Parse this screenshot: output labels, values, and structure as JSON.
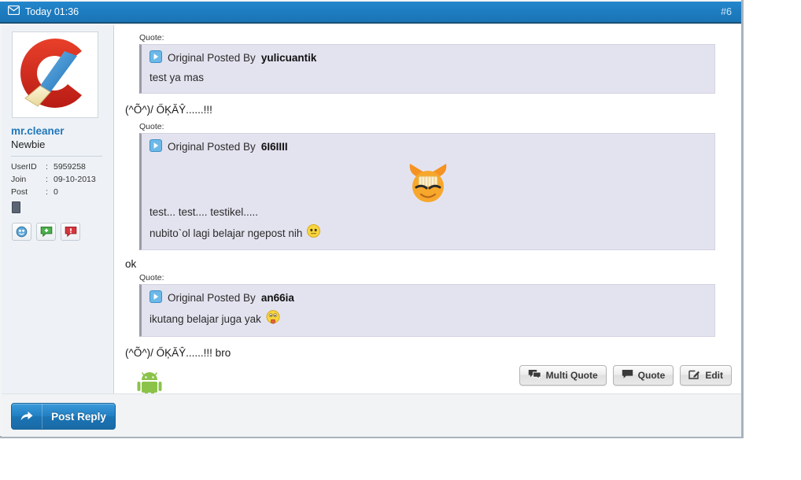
{
  "header": {
    "icon": "envelope-icon",
    "date": "Today 01:36",
    "post_number": "#6",
    "bg_color": "#1d7cc0"
  },
  "user": {
    "avatar_icon": "ccleaner-logo-avatar",
    "username": "mr.cleaner",
    "usertitle": "Newbie",
    "stats": [
      {
        "label": "UserID",
        "sep": ":",
        "value": "5959258"
      },
      {
        "label": "Join",
        "sep": ":",
        "value": "09-10-2013"
      },
      {
        "label": "Post",
        "sep": ":",
        "value": "0"
      }
    ],
    "device_badge": "mobile-device-icon",
    "mini_buttons": [
      {
        "name": "profile-globe-icon"
      },
      {
        "name": "reputation-add-icon"
      },
      {
        "name": "report-post-icon"
      }
    ]
  },
  "message": {
    "quote_label": "Quote:",
    "attrib_prefix": "Original Posted By",
    "blocks": [
      {
        "type": "quote",
        "author": "yulicuantik",
        "lines": [
          "test ya mas"
        ],
        "has_media": false,
        "emoticon": null
      },
      {
        "type": "text",
        "text": "(^Õ^)/ ŐĶĂŶ......!!!"
      },
      {
        "type": "quote",
        "author": "6I6IIII",
        "lines": [
          "test... test.... testikel.....",
          "nubito`ol lagi belajar ngepost nih"
        ],
        "has_media": true,
        "media_icon": "orange-laughing-face-emoticon",
        "emoticon": "yellow-smiley-emoticon"
      },
      {
        "type": "text",
        "text": "ok"
      },
      {
        "type": "quote",
        "author": "an66ia",
        "lines": [
          "ikutang belajar juga yak"
        ],
        "has_media": false,
        "emoticon": "tongue-out-emoticon"
      },
      {
        "type": "text",
        "text": "(^Õ^)/ ŐĶĂŶ......!!! bro"
      }
    ],
    "signature_icon": "android-robot-icon"
  },
  "actions": [
    {
      "name": "multi-quote-button",
      "label": "Multi Quote",
      "icon": "double-speech-bubble-icon"
    },
    {
      "name": "quote-button",
      "label": "Quote",
      "icon": "speech-bubble-icon"
    },
    {
      "name": "edit-button",
      "label": "Edit",
      "icon": "pencil-square-icon"
    }
  ],
  "footer": {
    "post_reply_label": "Post Reply",
    "post_reply_icon": "reply-arrow-icon"
  }
}
